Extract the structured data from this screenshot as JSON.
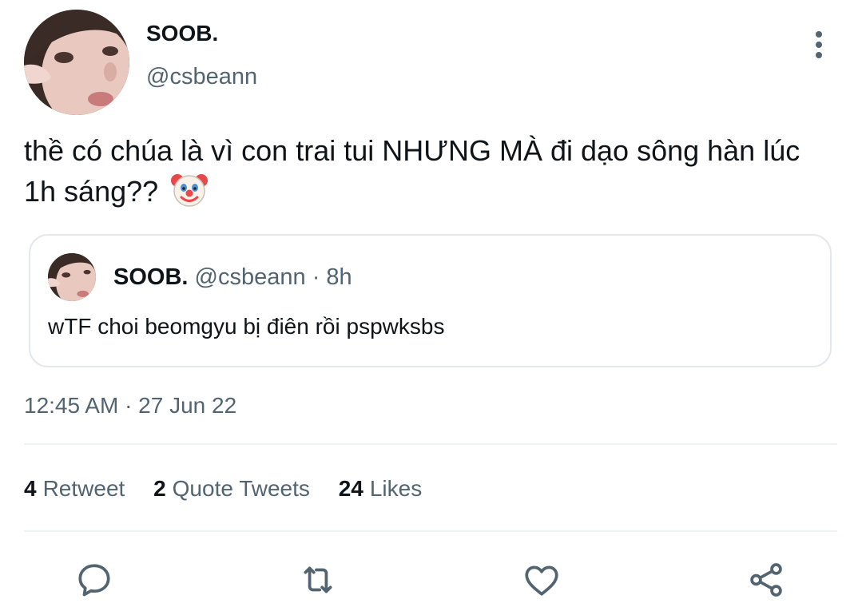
{
  "author": {
    "display_name": "SOOB.",
    "handle": "@csbeann"
  },
  "tweet": {
    "text": "thề có chúa là vì con trai tui NHƯNG MÀ đi dạo sông hàn lúc 1h sáng??",
    "emoji_icon": "clown-face-icon",
    "timestamp": "12:45 AM · 27 Jun 22"
  },
  "quoted_tweet": {
    "display_name": "SOOB.",
    "handle": "@csbeann",
    "separator": "·",
    "time": "8h",
    "text": "wTF choi beomgyu bị điên rồi pspwksbs"
  },
  "stats": {
    "retweets": {
      "count": "4",
      "label": "Retweet"
    },
    "quotes": {
      "count": "2",
      "label": "Quote Tweets"
    },
    "likes": {
      "count": "24",
      "label": "Likes"
    }
  },
  "actions": [
    "reply-icon",
    "retweet-icon",
    "like-icon",
    "share-icon"
  ],
  "colors": {
    "text_primary": "#0f1419",
    "text_secondary": "#536471",
    "border": "#e3e8ec",
    "divider": "#eff3f4",
    "icon": "#536471"
  }
}
